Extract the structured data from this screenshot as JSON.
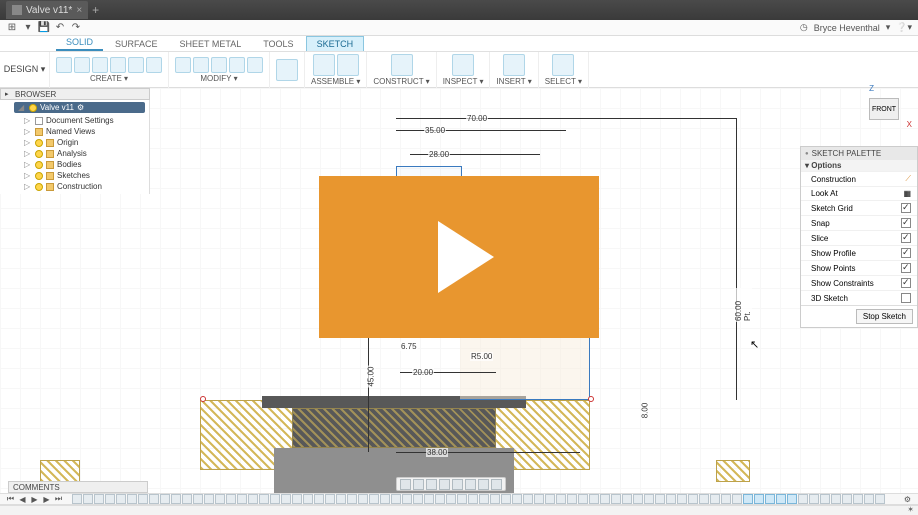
{
  "titlebar": {
    "doc_name": "Valve v11*"
  },
  "user": {
    "name": "Bryce Heventhal"
  },
  "ribbon_tabs": [
    "SOLID",
    "SURFACE",
    "SHEET METAL",
    "TOOLS",
    "SKETCH"
  ],
  "active_tab": "SKETCH",
  "design_label": "DESIGN ▾",
  "groups": {
    "create": "CREATE ▾",
    "modify": "MODIFY ▾",
    "assemble": "ASSEMBLE ▾",
    "construct": "CONSTRUCT ▾",
    "inspect": "INSPECT ▾",
    "insert": "INSERT ▾",
    "select": "SELECT ▾"
  },
  "browser": {
    "header": "BROWSER",
    "root": "Valve v11",
    "items": [
      "Document Settings",
      "Named Views",
      "Origin",
      "Analysis",
      "Bodies",
      "Sketches",
      "Construction"
    ]
  },
  "viewcube": {
    "face": "FRONT",
    "z": "Z",
    "x": "X"
  },
  "palette": {
    "title": "SKETCH PALETTE",
    "section": "▾ Options",
    "rows": [
      {
        "label": "Construction",
        "checked": false,
        "icon": true
      },
      {
        "label": "Look At",
        "checked": false,
        "icon": true
      },
      {
        "label": "Sketch Grid",
        "checked": true
      },
      {
        "label": "Snap",
        "checked": true
      },
      {
        "label": "Slice",
        "checked": true
      },
      {
        "label": "Show Profile",
        "checked": true
      },
      {
        "label": "Show Points",
        "checked": true
      },
      {
        "label": "Show Constraints",
        "checked": true
      },
      {
        "label": "3D Sketch",
        "checked": false
      }
    ],
    "stop": "Stop Sketch"
  },
  "dimensions": {
    "d70": "70.00",
    "d35": "35.00",
    "d28": "28.00",
    "d675": "6.75",
    "d20": "20.00",
    "d45": "45.00",
    "d38": "38.00",
    "r5": "R5.00",
    "d60": "60.00 Pt.",
    "d8": "8.00"
  },
  "comments": "COMMENTS"
}
